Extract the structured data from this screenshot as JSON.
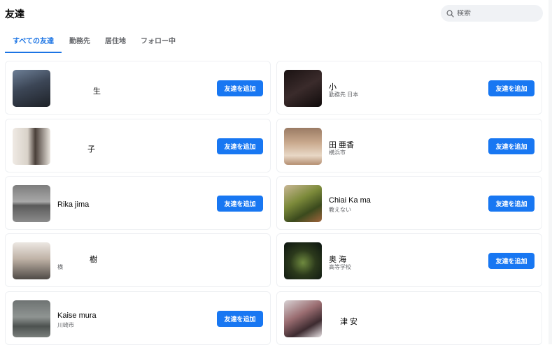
{
  "header": {
    "title": "友達"
  },
  "search": {
    "placeholder": "検索"
  },
  "tabs": [
    {
      "label": "すべての友達",
      "active": true
    },
    {
      "label": "勤務先",
      "active": false
    },
    {
      "label": "居住地",
      "active": false
    },
    {
      "label": "フォロー中",
      "active": false
    }
  ],
  "friends": [
    {
      "name": "生",
      "sub": "",
      "button": "友達を追加"
    },
    {
      "name": "小",
      "sub": "勤務先 日本",
      "button": "友達を追加"
    },
    {
      "name": "子",
      "sub": "",
      "button": "友達を追加"
    },
    {
      "name": "田 亜香",
      "sub": "横浜市",
      "button": "友達を追加"
    },
    {
      "name": "Rika jima",
      "sub": "",
      "button": "友達を追加"
    },
    {
      "name": "Chiai Ka ma",
      "sub": "教えない",
      "button": "友達を追加"
    },
    {
      "name": "樹",
      "sub": "横",
      "button": ""
    },
    {
      "name": "奥 海",
      "sub": "高等学校",
      "button": "友達を追加"
    },
    {
      "name": "Kaise mura",
      "sub": "川崎市",
      "button": "友達を追加"
    },
    {
      "name": "津 安",
      "sub": "",
      "button": ""
    }
  ]
}
